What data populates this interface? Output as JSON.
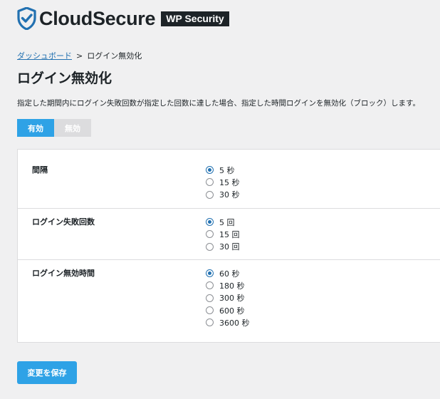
{
  "brand": {
    "name": "CloudSecure",
    "badge": "WP Security",
    "accent": "#2271b1"
  },
  "breadcrumb": {
    "home": "ダッシュボード",
    "separator": ">",
    "current": "ログイン無効化"
  },
  "page": {
    "title": "ログイン無効化",
    "description": "指定した期間内にログイン失敗回数が指定した回数に達した場合、指定した時間ログインを無効化（ブロック）します。"
  },
  "toggle": {
    "enabled_label": "有効",
    "disabled_label": "無効",
    "selected": "有効"
  },
  "settings": [
    {
      "label": "間隔",
      "options": [
        "5 秒",
        "15 秒",
        "30 秒"
      ],
      "selected": 0
    },
    {
      "label": "ログイン失敗回数",
      "options": [
        "5 回",
        "15 回",
        "30 回"
      ],
      "selected": 0
    },
    {
      "label": "ログイン無効時間",
      "options": [
        "60 秒",
        "180 秒",
        "300 秒",
        "600 秒",
        "3600 秒"
      ],
      "selected": 0
    }
  ],
  "save_button": "変更を保存"
}
